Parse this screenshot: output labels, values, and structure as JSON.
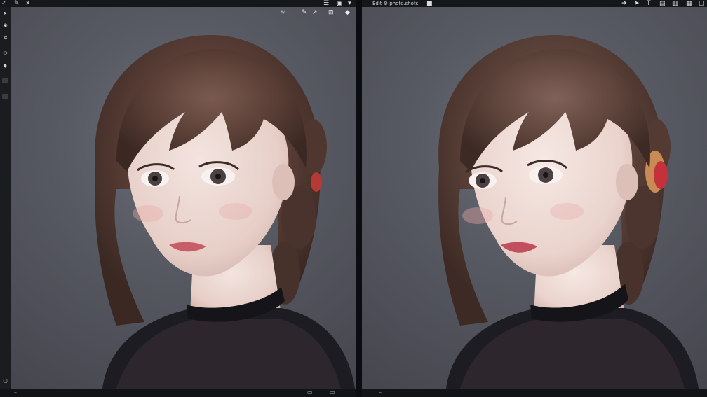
{
  "left_window": {
    "toolbar_icons": [
      "check-icon",
      "brush-icon",
      "close-icon"
    ],
    "right_toolbar_icons": [
      "menu-icon",
      "save-icon"
    ]
  },
  "left_canvas": {
    "overlay_icons": [
      "wifi-icon",
      "pen-icon",
      "arrow-icon",
      "frame-icon",
      "drop-icon"
    ],
    "image_name": "portrait-photo"
  },
  "right_window": {
    "title": "Edit ⚙ photo.shots",
    "toolbar_icons": [
      "arrow-icon",
      "pointer-icon",
      "text-icon",
      "layer-icon",
      "trash-icon",
      "settings-icon"
    ]
  },
  "right_canvas": {
    "image_name": "portrait-photo-enhanced"
  },
  "sidebar": {
    "icons": [
      "pointer-icon",
      "circle-icon",
      "adjust-icon",
      "filter-icon",
      "stamp-icon"
    ]
  },
  "colors": {
    "chrome_bg": "#16171a",
    "panel_bg": "#585a63",
    "hair": "#5a3f36",
    "skin": "#e9d3cc",
    "dress": "#1d1c22"
  }
}
